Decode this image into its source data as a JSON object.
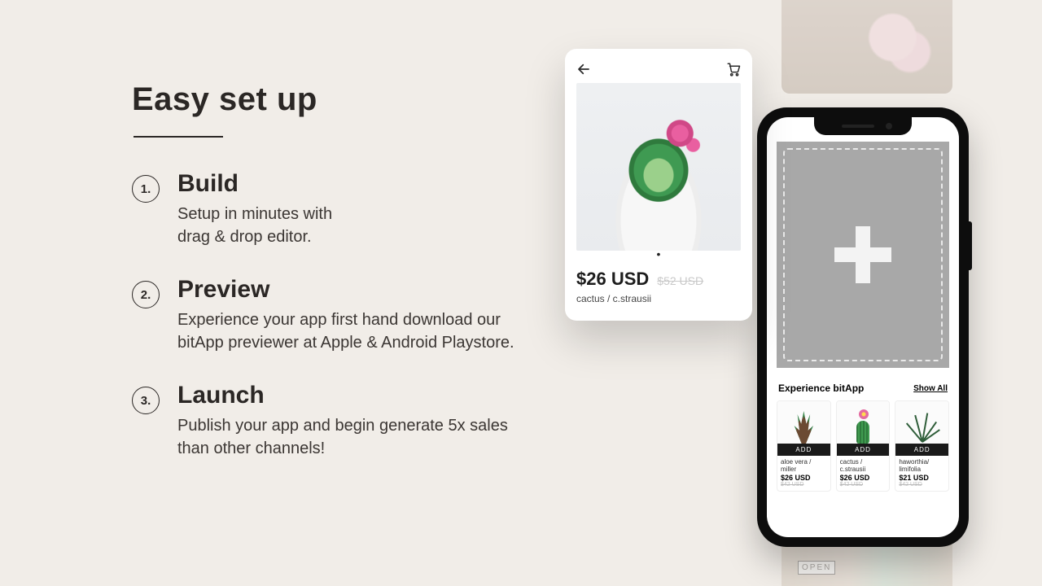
{
  "heading": "Easy set up",
  "steps": [
    {
      "num": "1.",
      "title": "Build",
      "body": "Setup in minutes with\ndrag & drop editor."
    },
    {
      "num": "2.",
      "title": "Preview",
      "body": "Experience your app first hand download our bitApp previewer at Apple & Android Playstore."
    },
    {
      "num": "3.",
      "title": "Launch",
      "body": "Publish your app and begin generate 5x sales than other channels!"
    }
  ],
  "floating_card": {
    "price": "$26 USD",
    "compare_price": "$52 USD",
    "title": "cactus / c.strausii",
    "dot": "•"
  },
  "phone": {
    "section_title": "Experience bitApp",
    "show_all": "Show All",
    "add_label": "ADD",
    "products": [
      {
        "name": "aloe vera / miller",
        "price": "$26 USD",
        "compare": "$42 USD"
      },
      {
        "name": "cactus / c.strausii",
        "price": "$26 USD",
        "compare": "$42 USD"
      },
      {
        "name": "haworthia/ limifolia",
        "price": "$21 USD",
        "compare": "$42 USD"
      }
    ]
  },
  "open_sign": "OPEN"
}
